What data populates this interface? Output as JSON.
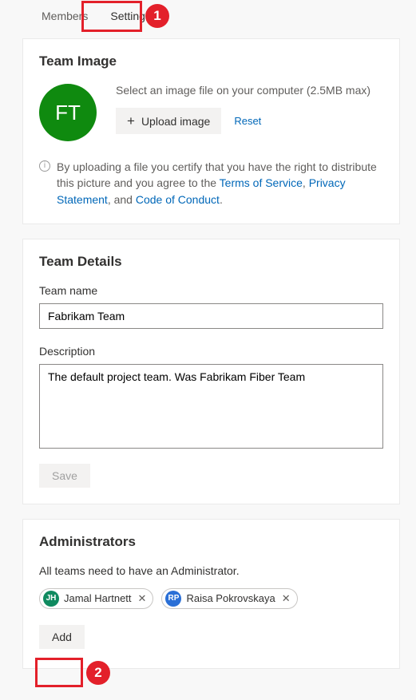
{
  "tabs": {
    "members": "Members",
    "settings": "Settings"
  },
  "callouts": {
    "one": "1",
    "two": "2"
  },
  "teamImage": {
    "heading": "Team Image",
    "avatarInitials": "FT",
    "hint": "Select an image file on your computer (2.5MB max)",
    "uploadLabel": "Upload image",
    "resetLabel": "Reset",
    "legalPrefix": "By uploading a file you certify that you have the right to distribute this picture and you agree to the ",
    "tos": "Terms of Service",
    "privacy": "Privacy Statement",
    "coc": "Code of Conduct",
    "sep1": ", ",
    "sep2": ", and ",
    "period": "."
  },
  "teamDetails": {
    "heading": "Team Details",
    "nameLabel": "Team name",
    "nameValue": "Fabrikam Team",
    "descLabel": "Description",
    "descValue": "The default project team. Was Fabrikam Fiber Team",
    "saveLabel": "Save"
  },
  "admins": {
    "heading": "Administrators",
    "hint": "All teams need to have an Administrator.",
    "people": [
      {
        "initials": "JH",
        "name": "Jamal Hartnett",
        "color": "#0f8a5f"
      },
      {
        "initials": "RP",
        "name": "Raisa Pokrovskaya",
        "color": "#2a6fd6"
      }
    ],
    "addLabel": "Add"
  }
}
